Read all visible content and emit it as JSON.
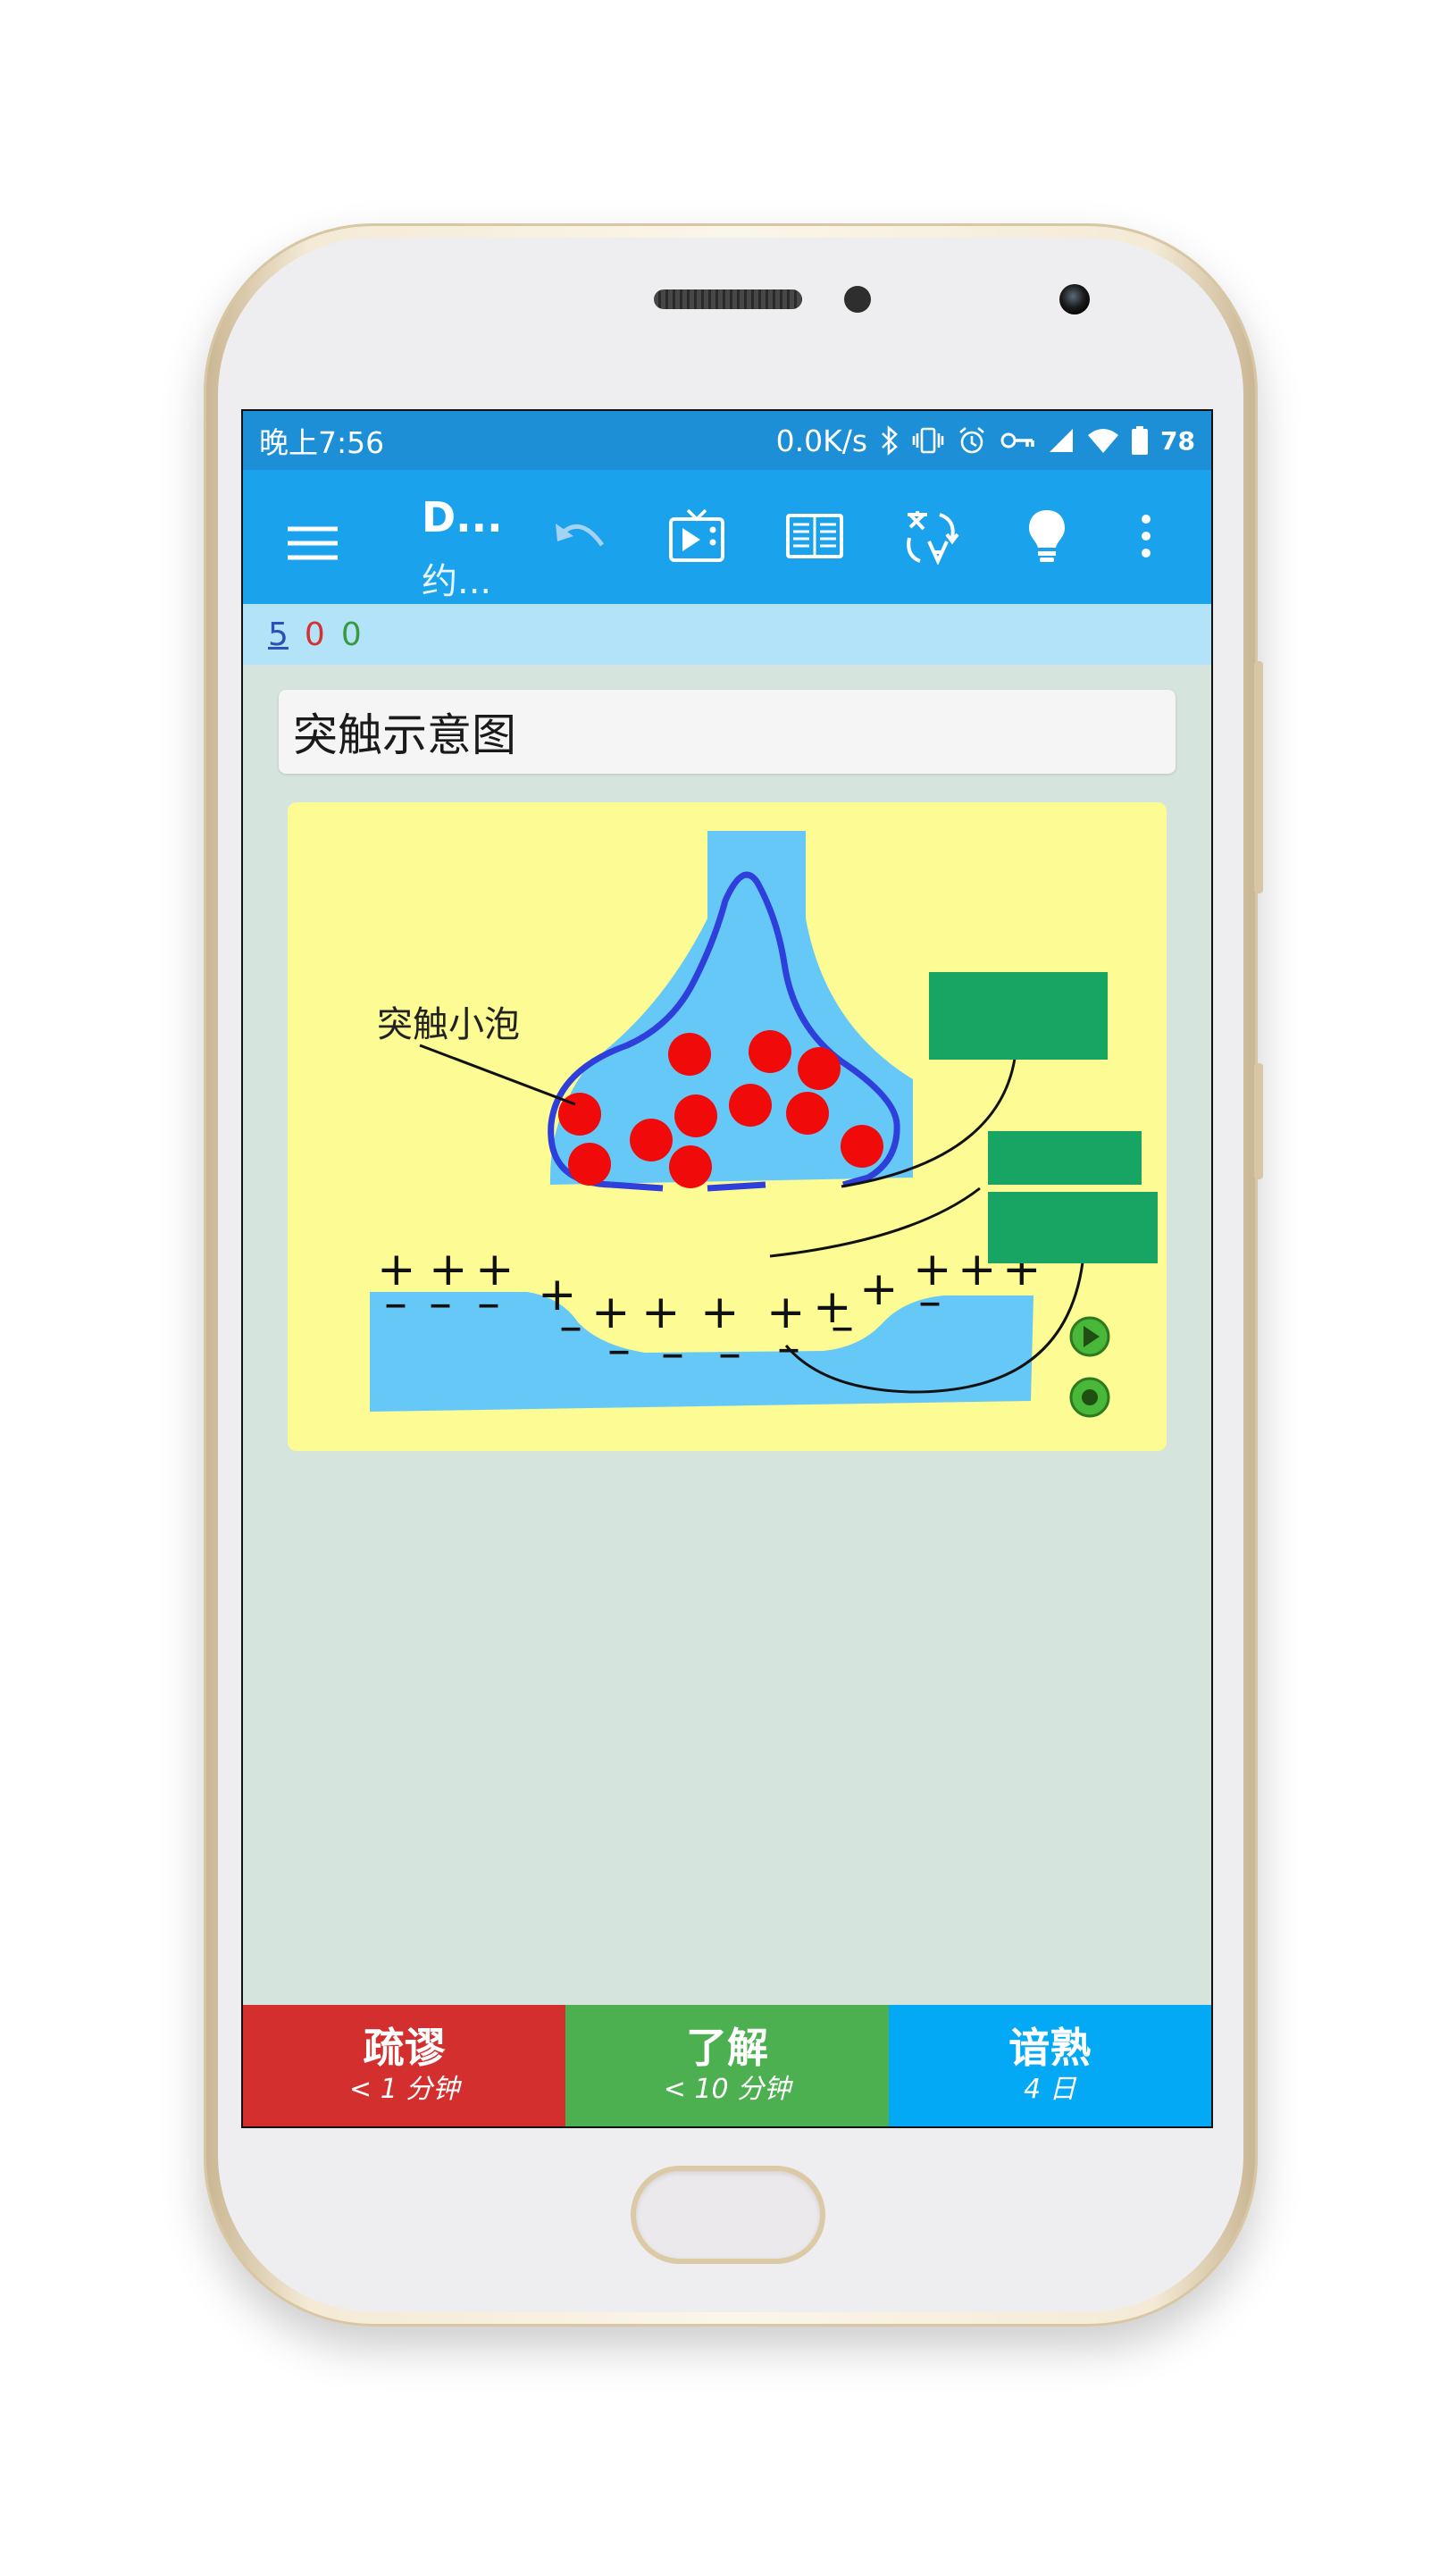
{
  "status_bar": {
    "time": "晚上7:56",
    "net_speed": "0.0K/s",
    "battery": "78",
    "icons": [
      "bluetooth-icon",
      "vibrate-icon",
      "alarm-icon",
      "vpn-key-icon",
      "signal-icon",
      "wifi-icon",
      "battery-icon"
    ]
  },
  "toolbar": {
    "deck_title": "D...",
    "deck_subtitle": "约...",
    "buttons": [
      "menu-icon",
      "undo-icon",
      "media-icon",
      "card-browser-icon",
      "translate-icon",
      "lightbulb-icon",
      "overflow-icon"
    ]
  },
  "counts": {
    "new": "5",
    "learning": "0",
    "review": "0"
  },
  "card": {
    "question": "突触示意图",
    "figure_label": "突触小泡",
    "plus_signs": [
      "+",
      "+",
      "+",
      "+",
      "+",
      "+",
      "+",
      "+",
      "+",
      "+",
      "+",
      "+",
      "+"
    ],
    "minus_signs": [
      "–",
      "–",
      "–",
      "–",
      "–",
      "–",
      "–",
      "–",
      "–",
      "–"
    ]
  },
  "answers": [
    {
      "label": "疏谬",
      "time": "< 1 分钟",
      "color": "#d32f2f"
    },
    {
      "label": "了解",
      "time": "< 10 分钟",
      "color": "#4caf50"
    },
    {
      "label": "谙熟",
      "time": "4 日",
      "color": "#03a9f4"
    }
  ],
  "colors": {
    "toolbar": "#1ba2ec",
    "status_bar": "#1d8fd6",
    "screen_bg": "#d6e4de",
    "figure_bg": "#fdfb94",
    "membrane": "#66c8f7",
    "vesicle": "#f00a0a",
    "occlusion_box": "#18a563"
  }
}
